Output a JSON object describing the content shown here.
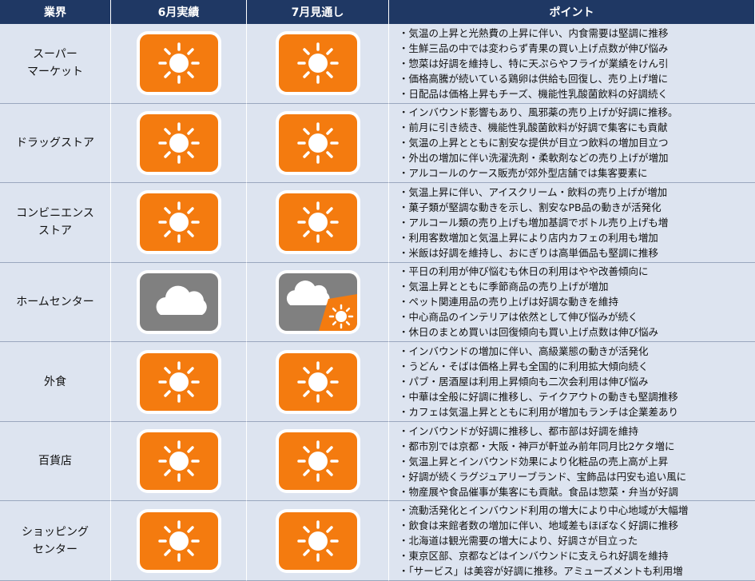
{
  "headers": [
    "業界",
    "6月実績",
    "7月見通し",
    "ポイント"
  ],
  "rows": [
    {
      "industry": "スーパー\nマーケット",
      "june": "sunny-icon",
      "july": "sunny-icon",
      "points": [
        "気温の上昇と光熱費の上昇に伴い、内食需要は堅調に推移",
        "生鮮三品の中では変わらず青果の買い上げ点数が伸び悩み",
        "惣菜は好調を維持し、特に天ぷらやフライが業績をけん引",
        "価格高騰が続いている鶏卵は供給も回復し、売り上げ増に",
        "日配品は価格上昇もチーズ、機能性乳酸菌飲料の好調続く"
      ]
    },
    {
      "industry": "ドラッグストア",
      "june": "sunny-icon",
      "july": "sunny-icon",
      "points": [
        "インバウンド影響もあり、風邪薬の売り上げが好調に推移。",
        "前月に引き続き、機能性乳酸菌飲料が好調で集客にも貢献",
        "気温の上昇とともに割安な提供が目立つ飲料の増加目立つ",
        "外出の増加に伴い洗濯洗剤・柔軟剤などの売り上げが増加",
        "アルコールのケース販売が郊外型店舗では集客要素に"
      ]
    },
    {
      "industry": "コンビニエンス\nストア",
      "june": "sunny-icon",
      "july": "sunny-icon",
      "points": [
        "気温上昇に伴い、アイスクリーム・飲料の売り上げが増加",
        "菓子類が堅調な動きを示し、割安なPB品の動きが活発化",
        "アルコール類の売り上げも増加基調でボトル売り上げも増",
        "利用客数増加と気温上昇により店内カフェの利用も増加",
        "米飯は好調を維持し、おにぎりは高単価品も堅調に推移"
      ]
    },
    {
      "industry": "ホームセンター",
      "june": "cloudy-icon",
      "july": "cloudy-sunny-icon",
      "points": [
        "平日の利用が伸び悩むも休日の利用はやや改善傾向に",
        "気温上昇とともに季節商品の売り上げが増加",
        "ペット関連用品の売り上げは好調な動きを維持",
        "中心商品のインテリアは依然として伸び悩みが続く",
        "休日のまとめ買いは回復傾向も買い上げ点数は伸び悩み"
      ]
    },
    {
      "industry": "外食",
      "june": "sunny-icon",
      "july": "sunny-icon",
      "points": [
        "インバウンドの増加に伴い、高級業態の動きが活発化",
        "うどん・そばは価格上昇も全国的に利用拡大傾向続く",
        "パブ・居酒屋は利用上昇傾向も二次会利用は伸び悩み",
        "中華は全般に好調に推移し、テイクアウトの動きも堅調推移",
        "カフェは気温上昇とともに利用が増加もランチは企業差あり"
      ]
    },
    {
      "industry": "百貨店",
      "june": "sunny-icon",
      "july": "sunny-icon",
      "points": [
        "インバウンドが好調に推移し、都市部は好調を維持",
        "都市別では京都・大阪・神戸が軒並み前年同月比2ケタ増に",
        "気温上昇とインバウンド効果により化粧品の売上高が上昇",
        "好調が続くラグジュアリーブランド、宝飾品は円安も追い風に",
        "物産展や食品催事が集客にも貢献。食品は惣菜・弁当が好調"
      ]
    },
    {
      "industry": "ショッピング\nセンター",
      "june": "sunny-icon",
      "july": "sunny-icon",
      "points": [
        "流動活発化とインバウンド利用の増大により中心地域が大幅増",
        "飲食は来館者数の増加に伴い、地域差もほぼなく好調に推移",
        "北海道は観光需要の増大により、好調さが目立った",
        "東京区部、京都などはインバウンドに支えられ好調を維持",
        "「サービス」は美容が好調に推移。アミューズメントも利用増"
      ]
    }
  ]
}
